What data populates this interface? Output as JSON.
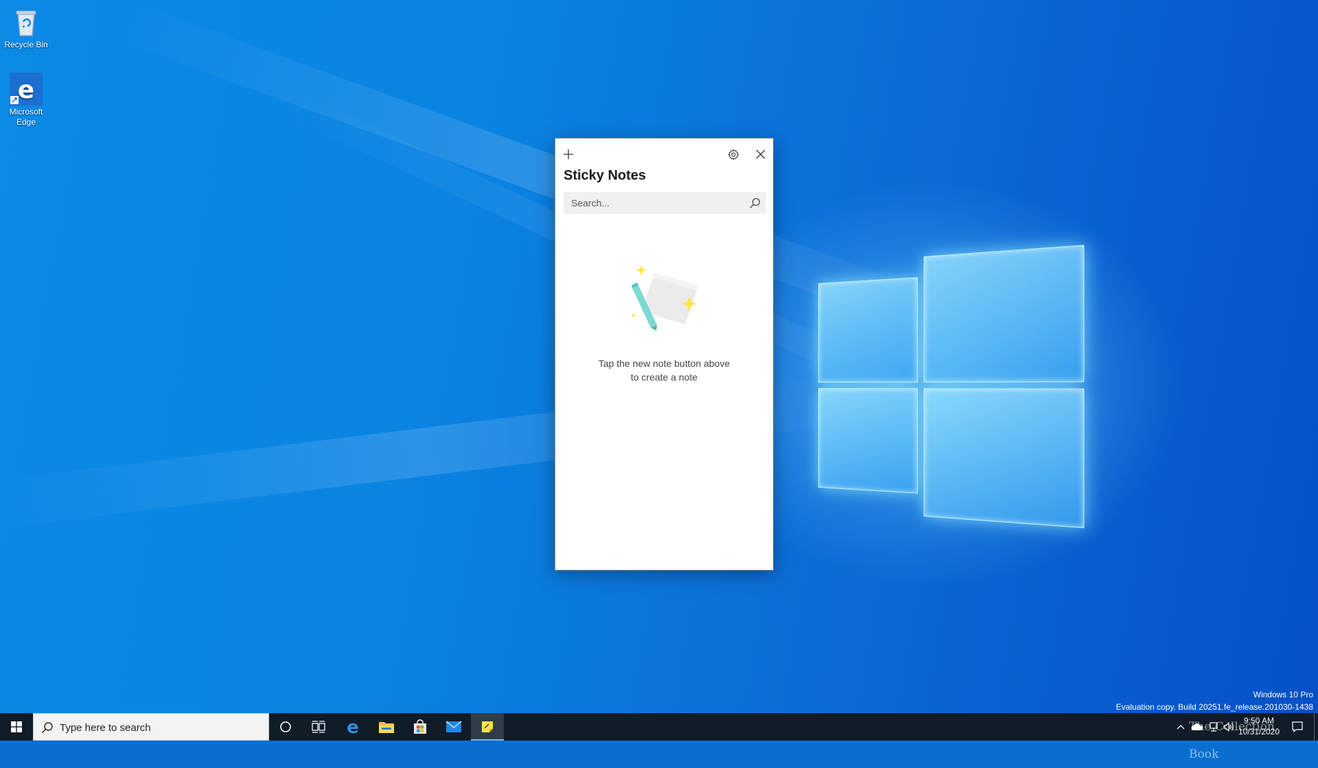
{
  "desktop": {
    "icons": [
      {
        "label": "Recycle Bin"
      },
      {
        "label": "Microsoft Edge"
      }
    ]
  },
  "sticky_notes": {
    "title": "Sticky Notes",
    "search_placeholder": "Search...",
    "empty_message_line1": "Tap the new note button above",
    "empty_message_line2": "to create a note"
  },
  "watermark": {
    "edition": "Windows 10 Pro",
    "build": "Evaluation copy. Build 20251.fe_release.201030-1438"
  },
  "taskbar": {
    "search_placeholder": "Type here to search",
    "pinned": [
      "cortana",
      "task-view",
      "microsoft-edge",
      "file-explorer",
      "microsoft-store",
      "mail",
      "sticky-notes"
    ],
    "active_app": "sticky-notes",
    "clock_time": "9:50 AM",
    "clock_date": "10/31/2020",
    "brand_text": "The Collection Book"
  },
  "colors": {
    "desktop_blue": "#0a6ed0",
    "taskbar": "#101c28",
    "sticky_yellow": "#ffe34d",
    "accent": "#0078d7"
  }
}
